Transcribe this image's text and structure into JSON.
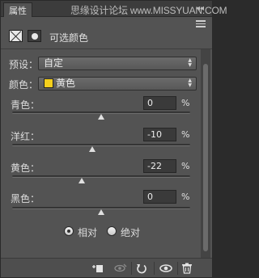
{
  "panel": {
    "tab_label": "属性",
    "watermark": "思缘设计论坛 www.MISSYUAN.COM",
    "collapse_glyph": "◂◂",
    "title": "可选颜色"
  },
  "preset": {
    "label": "预设：",
    "value": "自定"
  },
  "colors": {
    "label": "颜色：",
    "value": "黄色",
    "swatch": "#f4cf1d"
  },
  "sliders": [
    {
      "label": "青色：",
      "value": "0",
      "unit": "%",
      "level": 0.5
    },
    {
      "label": "洋红：",
      "value": "-10",
      "unit": "%",
      "level": 0.45
    },
    {
      "label": "黄色：",
      "value": "-22",
      "unit": "%",
      "level": 0.39
    },
    {
      "label": "黑色：",
      "value": "0",
      "unit": "%",
      "level": 0.5
    }
  ],
  "method": {
    "relative": "相对",
    "absolute": "绝对",
    "selected": "relative"
  },
  "footer_icons": [
    "clip-to-layer-icon",
    "view-previous-state-icon",
    "reset-icon",
    "visibility-eye-icon",
    "trash-icon"
  ]
}
